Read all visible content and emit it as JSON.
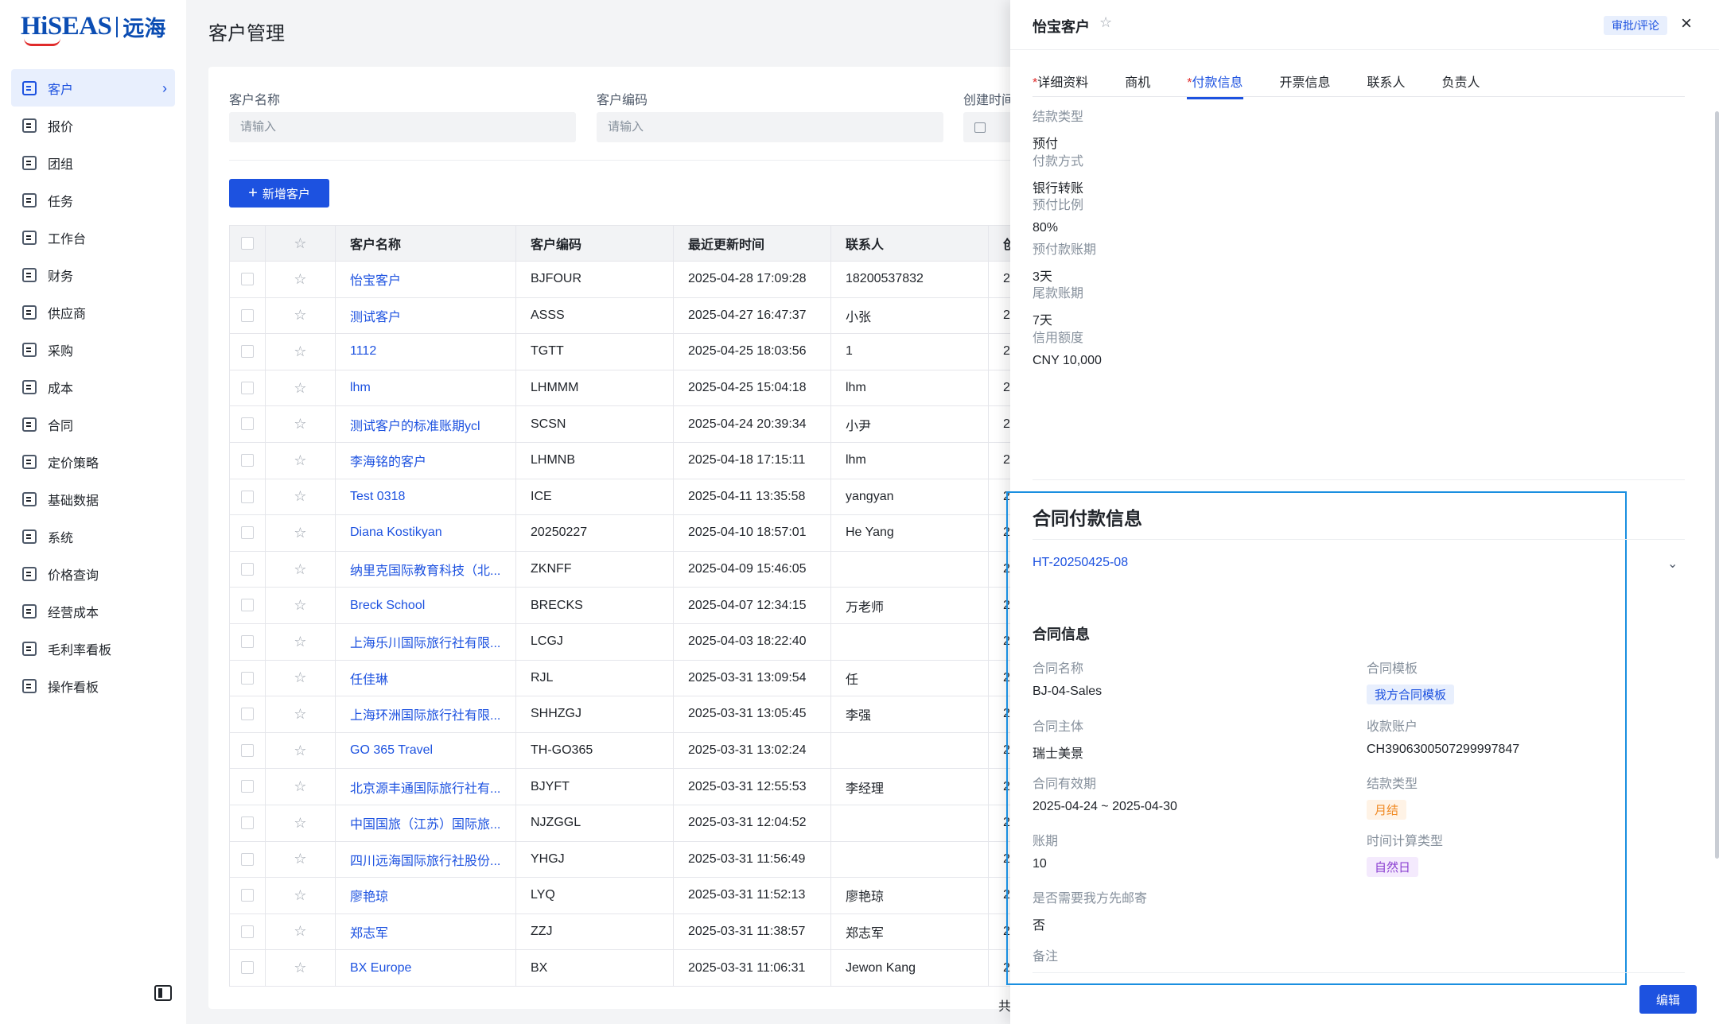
{
  "brand": {
    "logo_en": "HiSEAS",
    "logo_cn": "远海"
  },
  "sidebar": {
    "items": [
      {
        "label": "客户",
        "icon": "customer-icon",
        "active": true
      },
      {
        "label": "报价",
        "icon": "quote-icon"
      },
      {
        "label": "团组",
        "icon": "group-icon"
      },
      {
        "label": "任务",
        "icon": "task-icon"
      },
      {
        "label": "工作台",
        "icon": "workbench-icon"
      },
      {
        "label": "财务",
        "icon": "finance-icon"
      },
      {
        "label": "供应商",
        "icon": "supplier-icon"
      },
      {
        "label": "采购",
        "icon": "purchase-icon"
      },
      {
        "label": "成本",
        "icon": "cost-icon"
      },
      {
        "label": "合同",
        "icon": "contract-icon"
      },
      {
        "label": "定价策略",
        "icon": "pricing-icon"
      },
      {
        "label": "基础数据",
        "icon": "folder-icon"
      },
      {
        "label": "系统",
        "icon": "settings-icon"
      },
      {
        "label": "价格查询",
        "icon": "price-search-icon"
      },
      {
        "label": "经营成本",
        "icon": "operating-cost-icon"
      },
      {
        "label": "毛利率看板",
        "icon": "dashboard-icon"
      },
      {
        "label": "操作看板",
        "icon": "ops-board-icon"
      }
    ]
  },
  "page": {
    "title": "客户管理"
  },
  "filters": {
    "name_label": "客户名称",
    "name_placeholder": "请输入",
    "code_label": "客户编码",
    "code_placeholder": "请输入",
    "created_label": "创建时间"
  },
  "actions": {
    "add_customer": "新增客户"
  },
  "table": {
    "headers": [
      "客户名称",
      "客户编码",
      "最近更新时间",
      "联系人",
      "创"
    ],
    "rows": [
      {
        "name": "怡宝客户",
        "code": "BJFOUR",
        "updated": "2025-04-28 17:09:28",
        "contact": "18200537832",
        "extra": "2"
      },
      {
        "name": "测试客户",
        "code": "ASSS",
        "updated": "2025-04-27 16:47:37",
        "contact": "小张",
        "extra": "2"
      },
      {
        "name": "1112",
        "code": "TGTT",
        "updated": "2025-04-25 18:03:56",
        "contact": "1",
        "extra": "2"
      },
      {
        "name": "lhm",
        "code": "LHMMM",
        "updated": "2025-04-25 15:04:18",
        "contact": "lhm",
        "extra": "2"
      },
      {
        "name": "测试客户的标准账期ycl",
        "code": "SCSN",
        "updated": "2025-04-24 20:39:34",
        "contact": "小尹",
        "extra": "2"
      },
      {
        "name": "李海铭的客户",
        "code": "LHMNB",
        "updated": "2025-04-18 17:15:11",
        "contact": "lhm",
        "extra": "2"
      },
      {
        "name": "Test 0318",
        "code": "ICE",
        "updated": "2025-04-11 13:35:58",
        "contact": "yangyan",
        "extra": "2"
      },
      {
        "name": "Diana Kostikyan",
        "code": "20250227",
        "updated": "2025-04-10 18:57:01",
        "contact": "He Yang",
        "extra": "2"
      },
      {
        "name": "纳里克国际教育科技（北...",
        "code": "ZKNFF",
        "updated": "2025-04-09 15:46:05",
        "contact": "",
        "extra": "2"
      },
      {
        "name": "Breck School",
        "code": "BRECKS",
        "updated": "2025-04-07 12:34:15",
        "contact": "万老师",
        "extra": "2"
      },
      {
        "name": "上海乐川国际旅行社有限...",
        "code": "LCGJ",
        "updated": "2025-04-03 18:22:40",
        "contact": "",
        "extra": "2"
      },
      {
        "name": "任佳琳",
        "code": "RJL",
        "updated": "2025-03-31 13:09:54",
        "contact": "任",
        "extra": "2"
      },
      {
        "name": "上海环洲国际旅行社有限...",
        "code": "SHHZGJ",
        "updated": "2025-03-31 13:05:45",
        "contact": "李强",
        "extra": "2"
      },
      {
        "name": "GO 365 Travel",
        "code": "TH-GO365",
        "updated": "2025-03-31 13:02:24",
        "contact": "",
        "extra": "2"
      },
      {
        "name": "北京源丰通国际旅行社有...",
        "code": "BJYFT",
        "updated": "2025-03-31 12:55:53",
        "contact": "李经理",
        "extra": "2"
      },
      {
        "name": "中国国旅（江苏）国际旅...",
        "code": "NJZGGL",
        "updated": "2025-03-31 12:04:52",
        "contact": "",
        "extra": "2"
      },
      {
        "name": "四川远海国际旅行社股份...",
        "code": "YHGJ",
        "updated": "2025-03-31 11:56:49",
        "contact": "",
        "extra": "2"
      },
      {
        "name": "廖艳琼",
        "code": "LYQ",
        "updated": "2025-03-31 11:52:13",
        "contact": "廖艳琼",
        "extra": "2"
      },
      {
        "name": "郑志军",
        "code": "ZZJ",
        "updated": "2025-03-31 11:38:57",
        "contact": "郑志军",
        "extra": "2"
      },
      {
        "name": "BX Europe",
        "code": "BX",
        "updated": "2025-03-31 11:06:31",
        "contact": "Jewon Kang",
        "extra": "2"
      }
    ]
  },
  "pager_peek": "共",
  "drawer": {
    "title": "怡宝客户",
    "approve_label": "审批/评论",
    "tabs": [
      {
        "label": "详细资料",
        "required": true
      },
      {
        "label": "商机",
        "required": false
      },
      {
        "label": "付款信息",
        "required": true,
        "active": true
      },
      {
        "label": "开票信息",
        "required": false
      },
      {
        "label": "联系人",
        "required": false
      },
      {
        "label": "负责人",
        "required": false
      }
    ],
    "payment": [
      {
        "label": "结款类型",
        "value": "预付"
      },
      {
        "label": "付款方式",
        "value": "银行转账"
      },
      {
        "label": "预付比例",
        "value": "80%"
      },
      {
        "label": "预付款账期",
        "value": "3天"
      },
      {
        "label": "尾款账期",
        "value": "7天"
      },
      {
        "label": "信用额度",
        "value": "CNY 10,000"
      }
    ],
    "contract_section_title": "合同付款信息",
    "contract_no": "HT-20250425-08",
    "contract_info_title": "合同信息",
    "contract_fields": {
      "name_label": "合同名称",
      "name_value": "BJ-04-Sales",
      "template_label": "合同模板",
      "template_value": "我方合同模板",
      "entity_label": "合同主体",
      "entity_value": "瑞士美景",
      "account_label": "收款账户",
      "account_value": "CH3906300507299997847",
      "validity_label": "合同有效期",
      "validity_value": "2025-04-24 ~ 2025-04-30",
      "settle_label": "结款类型",
      "settle_value": "月结",
      "period_label": "账期",
      "period_value": "10",
      "calc_label": "时间计算类型",
      "calc_value": "自然日",
      "mail_label": "是否需要我方先邮寄",
      "mail_value": "否",
      "remark_label": "备注"
    },
    "edit_label": "编辑"
  },
  "colors": {
    "primary": "#1d52e0",
    "highlight_border": "#1a8fe0",
    "brand_red": "#e02b2b"
  }
}
